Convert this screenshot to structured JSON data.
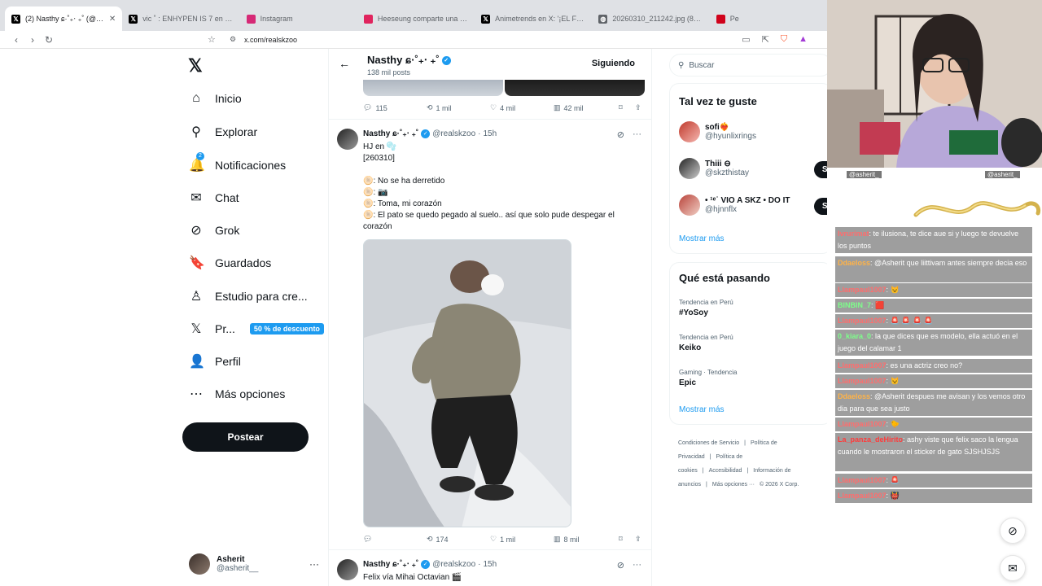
{
  "browser": {
    "tabs": [
      {
        "title": "(2) Nasthy ɕ·˚₊‧ ₊˚ (@realskzoo) /",
        "icon": "x-logo",
        "color": "#000000",
        "active": true
      },
      {
        "title": "vic ˚ : ENHYPEN IS 7 en X: '— Tradu",
        "icon": "x-logo",
        "color": "#000000",
        "active": false
      },
      {
        "title": "Instagram",
        "icon": "instagram-logo",
        "color": "#d62976",
        "active": false
      },
      {
        "title": "Heeseung comparte una carta tras s",
        "icon": "news-icon",
        "color": "#e0245e",
        "active": false
      },
      {
        "title": "Animetrends en X: '¡EL FINAL DE U",
        "icon": "x-logo",
        "color": "#000000",
        "active": false
      },
      {
        "title": "20260310_211242.jpg (820×1024)",
        "icon": "globe-icon",
        "color": "#5f6368",
        "active": false
      },
      {
        "title": "Pe",
        "icon": "c-logo",
        "color": "#d0021b",
        "active": false
      }
    ],
    "url": "x.com/realskzoo"
  },
  "leftnav": {
    "items": [
      {
        "label": "Inicio",
        "icon": "home-icon",
        "glyph": "⌂"
      },
      {
        "label": "Explorar",
        "icon": "search-icon",
        "glyph": "⚲"
      },
      {
        "label": "Notificaciones",
        "icon": "bell-icon",
        "glyph": "🔔",
        "badge": "2"
      },
      {
        "label": "Chat",
        "icon": "mail-icon",
        "glyph": "✉"
      },
      {
        "label": "Grok",
        "icon": "grok-icon",
        "glyph": "⊘"
      },
      {
        "label": "Guardados",
        "icon": "bookmark-icon",
        "glyph": "🔖"
      },
      {
        "label": "Estudio para cre...",
        "icon": "creator-icon",
        "glyph": "♙"
      },
      {
        "label": "Pr...",
        "icon": "x-premium-icon",
        "glyph": "𝕏",
        "promo": "50 % de descuento"
      },
      {
        "label": "Perfil",
        "icon": "profile-icon",
        "glyph": "👤"
      },
      {
        "label": "Más opciones",
        "icon": "more-circle-icon",
        "glyph": "⋯"
      }
    ],
    "post_label": "Postear",
    "account": {
      "name": "Asherit",
      "handle": "@asherit__"
    }
  },
  "profile_header": {
    "name": "Nasthy ɕ·˚₊‧ ₊˚",
    "posts": "138 mil posts",
    "following_label": "Siguiendo"
  },
  "tweet0_actions": {
    "replies": "115",
    "reposts": "1 mil",
    "likes": "4 mil",
    "views": "42 mil"
  },
  "tweet1": {
    "name": "Nasthy ɕ·˚₊‧ ₊˚",
    "handle": "@realskzoo",
    "time": "15h",
    "lines": [
      "HJ en 🫧",
      "[260310]",
      "",
      "🫓: No se ha derretido",
      "🫓: 📷",
      "🫓: Toma, mi corazón",
      "🫓: El pato se quedo pegado al suelo.. así que solo pude despegar el corazón"
    ],
    "actions": {
      "replies": "",
      "reposts": "174",
      "likes": "1 mil",
      "views": "8 mil"
    }
  },
  "tweet2": {
    "name": "Nasthy ɕ·˚₊‧ ₊˚",
    "handle": "@realskzoo",
    "time": "15h",
    "text": "Felix vía Mihai Octavian 🎬"
  },
  "right": {
    "search_placeholder": "Buscar",
    "who_title": "Tal vez te guste",
    "who": [
      {
        "name": "sofi❤️‍🔥",
        "handle": "@hyunlixrings",
        "button": "Se"
      },
      {
        "name": "Thiii ⊖",
        "handle": "@skzthistay",
        "button": "Seguir"
      },
      {
        "name": "• ¹ᵉ˙ VIO A SKZ • DO IT",
        "handle": "@hjnnflx",
        "button": "Seguir"
      }
    ],
    "who_more": "Mostrar más",
    "trends_title": "Qué está pasando",
    "trends": [
      {
        "context": "Tendencia en Perú",
        "topic": "#YoSoy"
      },
      {
        "context": "Tendencia en Perú",
        "topic": "Keiko"
      },
      {
        "context": "Gaming · Tendencia",
        "topic": "Epic"
      }
    ],
    "trends_more": "Mostrar más",
    "footer": [
      "Condiciones de Servicio",
      "|",
      "Política de Privacidad",
      "|",
      "Política de cookies",
      "|",
      "Accesibilidad",
      "|",
      "Información de anuncios",
      "|",
      "Más opciones ···",
      "© 2026 X Corp."
    ]
  },
  "stream": {
    "chat_top_names": [
      "@asherit_",
      "@asherit_"
    ],
    "chat": [
      {
        "user": "Ivrurimat",
        "cls": "u-red",
        "text": ": te ilusiona, te dice aue si y luego te devuelve los puntos"
      },
      {
        "user": "Ddaeloss",
        "cls": "u-org",
        "text": ": @Asherit que liittivam antes siempre decia eso"
      },
      {
        "user": "Llampaul1007",
        "cls": "u-red",
        "text": ": 😾"
      },
      {
        "user": "BINBIN_7",
        "cls": "u-grn",
        "text": ": 🟥"
      },
      {
        "user": "Llampaul1007",
        "cls": "u-red",
        "text": ": 🚨 🚨 🚨 🚨"
      },
      {
        "user": "0_kiara_0",
        "cls": "u-grn",
        "text": ": la que dices que es modelo, ella actuó en el juego del calamar 1"
      },
      {
        "user": "Llampaul1007",
        "cls": "u-red",
        "text": ": es una actriz creo no?"
      },
      {
        "user": "Llampaul1007",
        "cls": "u-red",
        "text": ": 😾"
      },
      {
        "user": "Ddaeloss",
        "cls": "u-org",
        "text": ": @Asherit despues me avisan y los vemos otro dia para que sea justo"
      },
      {
        "user": "Llampaul1007",
        "cls": "u-red",
        "text": ": 🐤"
      },
      {
        "user": "La_panza_deHirito",
        "cls": "u-darkred",
        "text": ": ashy viste que felix saco la lengua cuando le mostraron el sticker de gato SJSHJSJS"
      },
      {
        "user": "Llampaul1007",
        "cls": "u-red",
        "text": ": 🚨"
      },
      {
        "user": "Llampaul1007",
        "cls": "u-red",
        "text": ": 👹"
      }
    ]
  }
}
